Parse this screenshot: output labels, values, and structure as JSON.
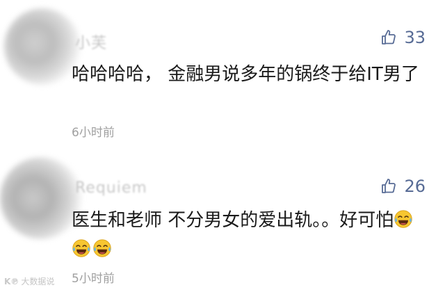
{
  "comments": [
    {
      "username": "小芙",
      "likes": "33",
      "text": "哈哈哈哈，  金融男说多年的锅终于给IT男了",
      "time": "6小时前",
      "emoji_count": 0
    },
    {
      "username": "Requiem",
      "likes": "26",
      "text": "医生和老师 不分男女的爱出轨。。好可怕",
      "time": "5小时前",
      "emoji_count": 3
    }
  ],
  "icons": {
    "like": "thumbs-up-icon",
    "emoji": "tears-of-joy-emoji-icon"
  },
  "colors": {
    "like_count": "#576b95",
    "time": "#a0a0a0",
    "text": "#1a1a1a"
  },
  "watermark": {
    "logo": "K℗",
    "text": "大数据说"
  }
}
